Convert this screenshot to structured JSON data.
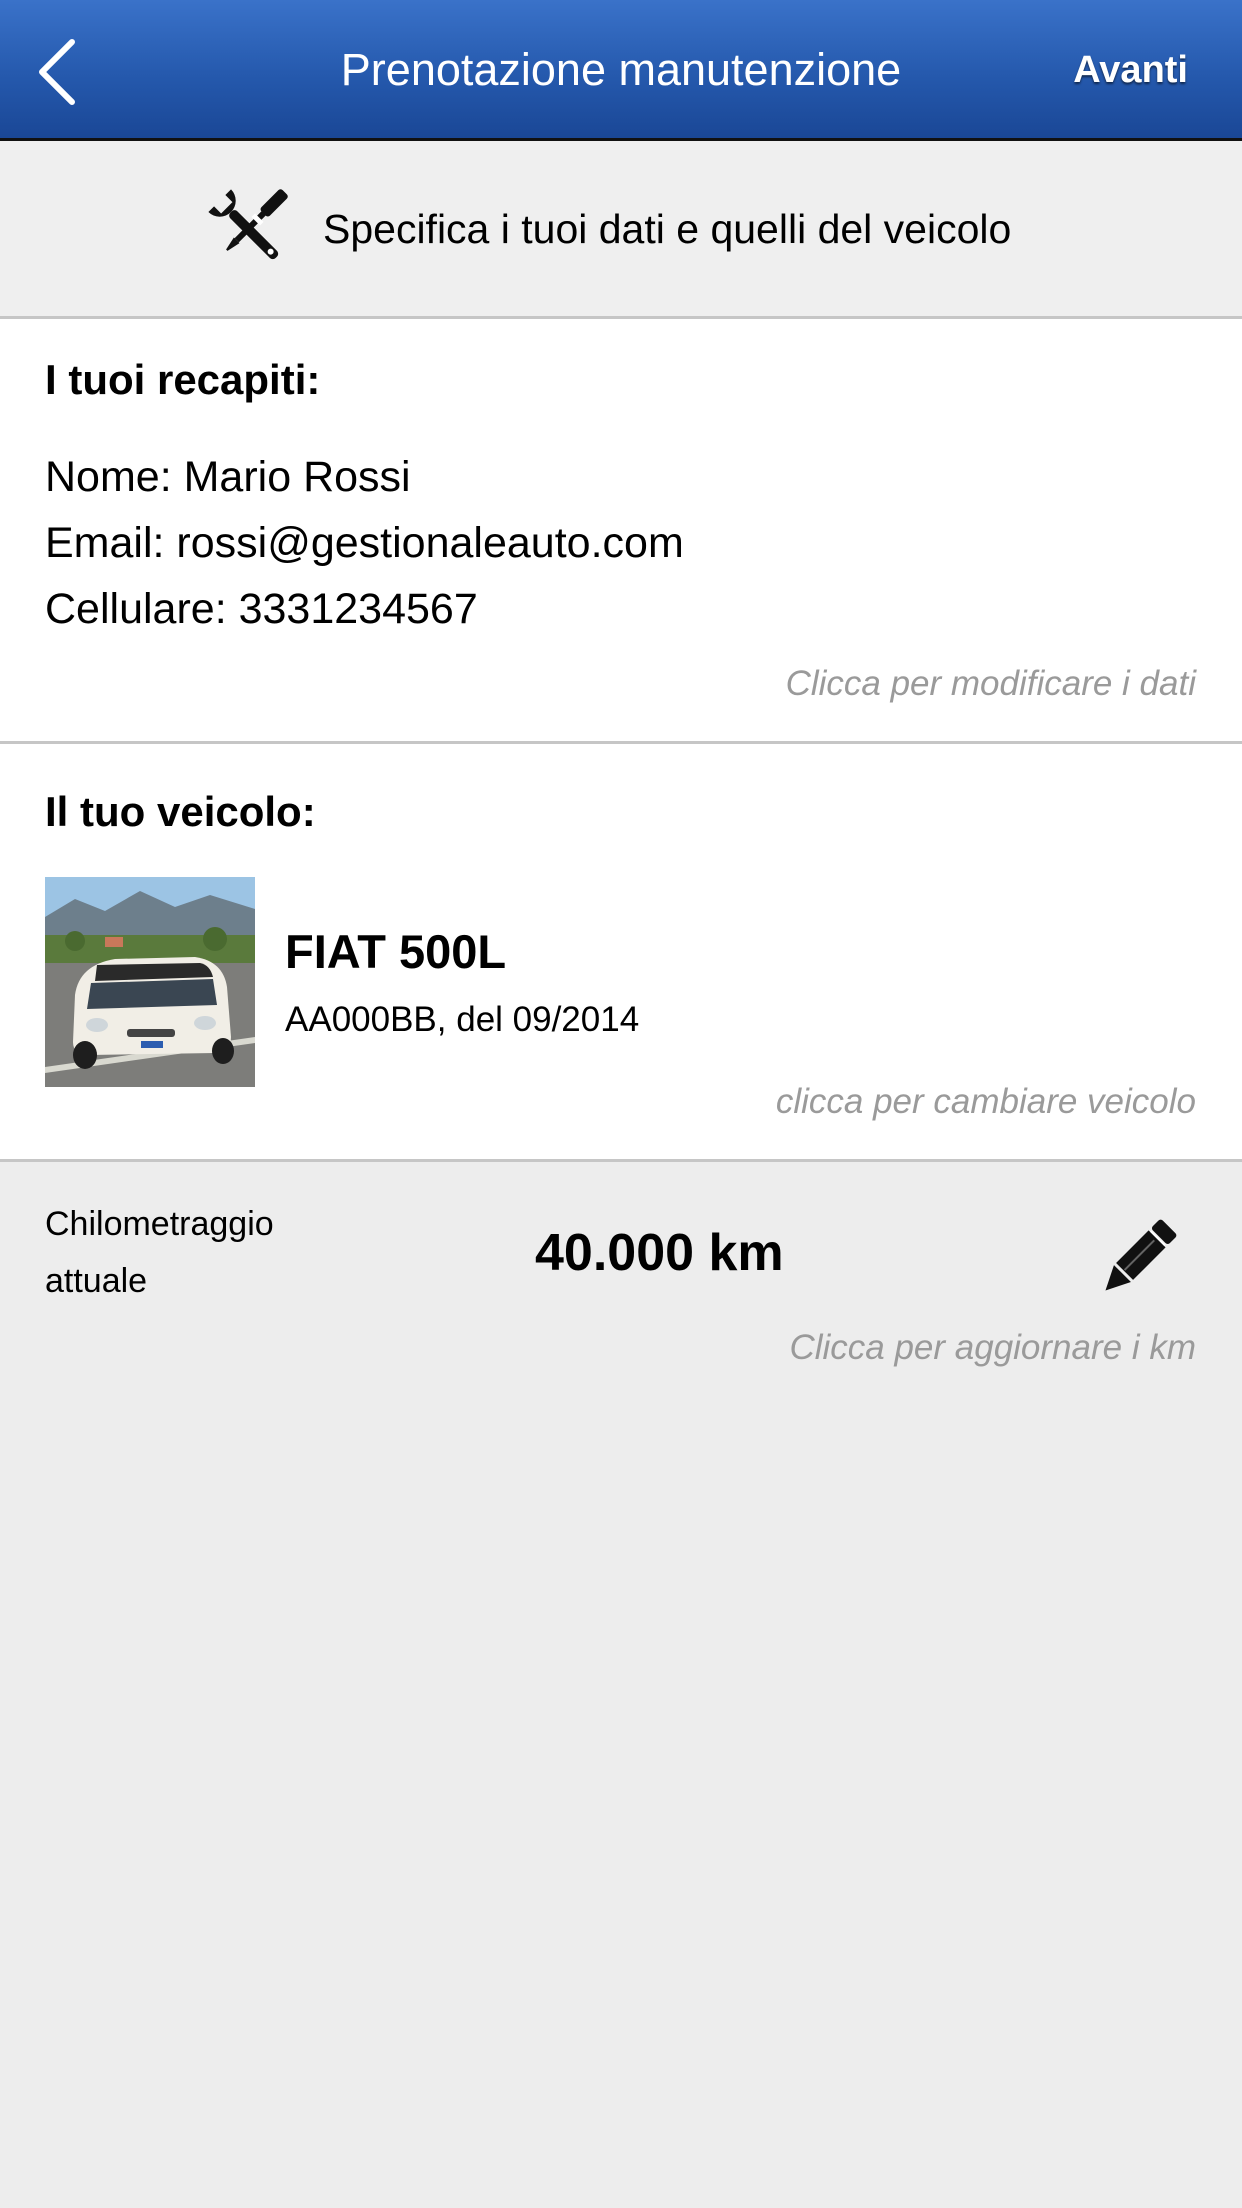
{
  "navbar": {
    "title": "Prenotazione manutenzione",
    "next_label": "Avanti",
    "back_icon": "chevron-left-icon",
    "background": "#2559ad"
  },
  "subheader": {
    "icon": "tools-icon",
    "text": "Specifica i tuoi dati e quelli del veicolo"
  },
  "contact": {
    "title": "I tuoi recapiti:",
    "name_line": "Nome: Mario Rossi",
    "email_line": "Email: rossi@gestionaleauto.com",
    "phone_line": "Cellulare: 3331234567",
    "hint": "Clicca per modificare i dati"
  },
  "vehicle": {
    "title": "Il tuo veicolo:",
    "model": "FIAT 500L",
    "plate_date": "AA000BB, del 09/2014",
    "hint": "clicca per cambiare veicolo"
  },
  "mileage": {
    "label": "Chilometraggio attuale",
    "value": "40.000 km",
    "edit_icon": "pencil-icon",
    "hint": "Clicca per aggiornare i km"
  }
}
